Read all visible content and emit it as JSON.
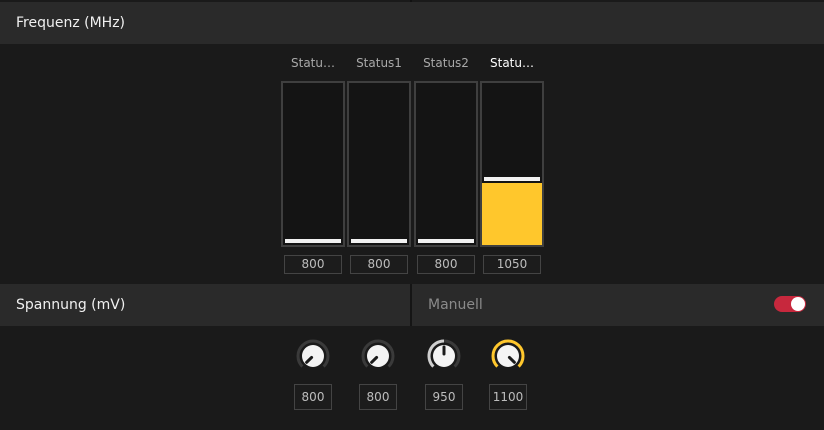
{
  "frequency": {
    "title": "Frequenz (MHz)",
    "fill_color": "#ffc72c",
    "bars": [
      {
        "label": "Statu…",
        "value": "800",
        "level": 0.0,
        "active": false
      },
      {
        "label": "Status1",
        "value": "800",
        "level": 0.0,
        "active": false
      },
      {
        "label": "Status2",
        "value": "800",
        "level": 0.0,
        "active": false
      },
      {
        "label": "Statu…",
        "value": "1050",
        "level": 0.38,
        "active": true
      }
    ]
  },
  "voltage": {
    "title": "Spannung (mV)",
    "manual_label": "Manuell",
    "manual_enabled": true,
    "toggle_color": "#c7283d",
    "knobs": [
      {
        "value": "800",
        "level": 0.0,
        "active": false
      },
      {
        "value": "800",
        "level": 0.0,
        "active": false
      },
      {
        "value": "950",
        "level": 0.5,
        "active": false
      },
      {
        "value": "1100",
        "level": 1.0,
        "active": true
      }
    ]
  }
}
